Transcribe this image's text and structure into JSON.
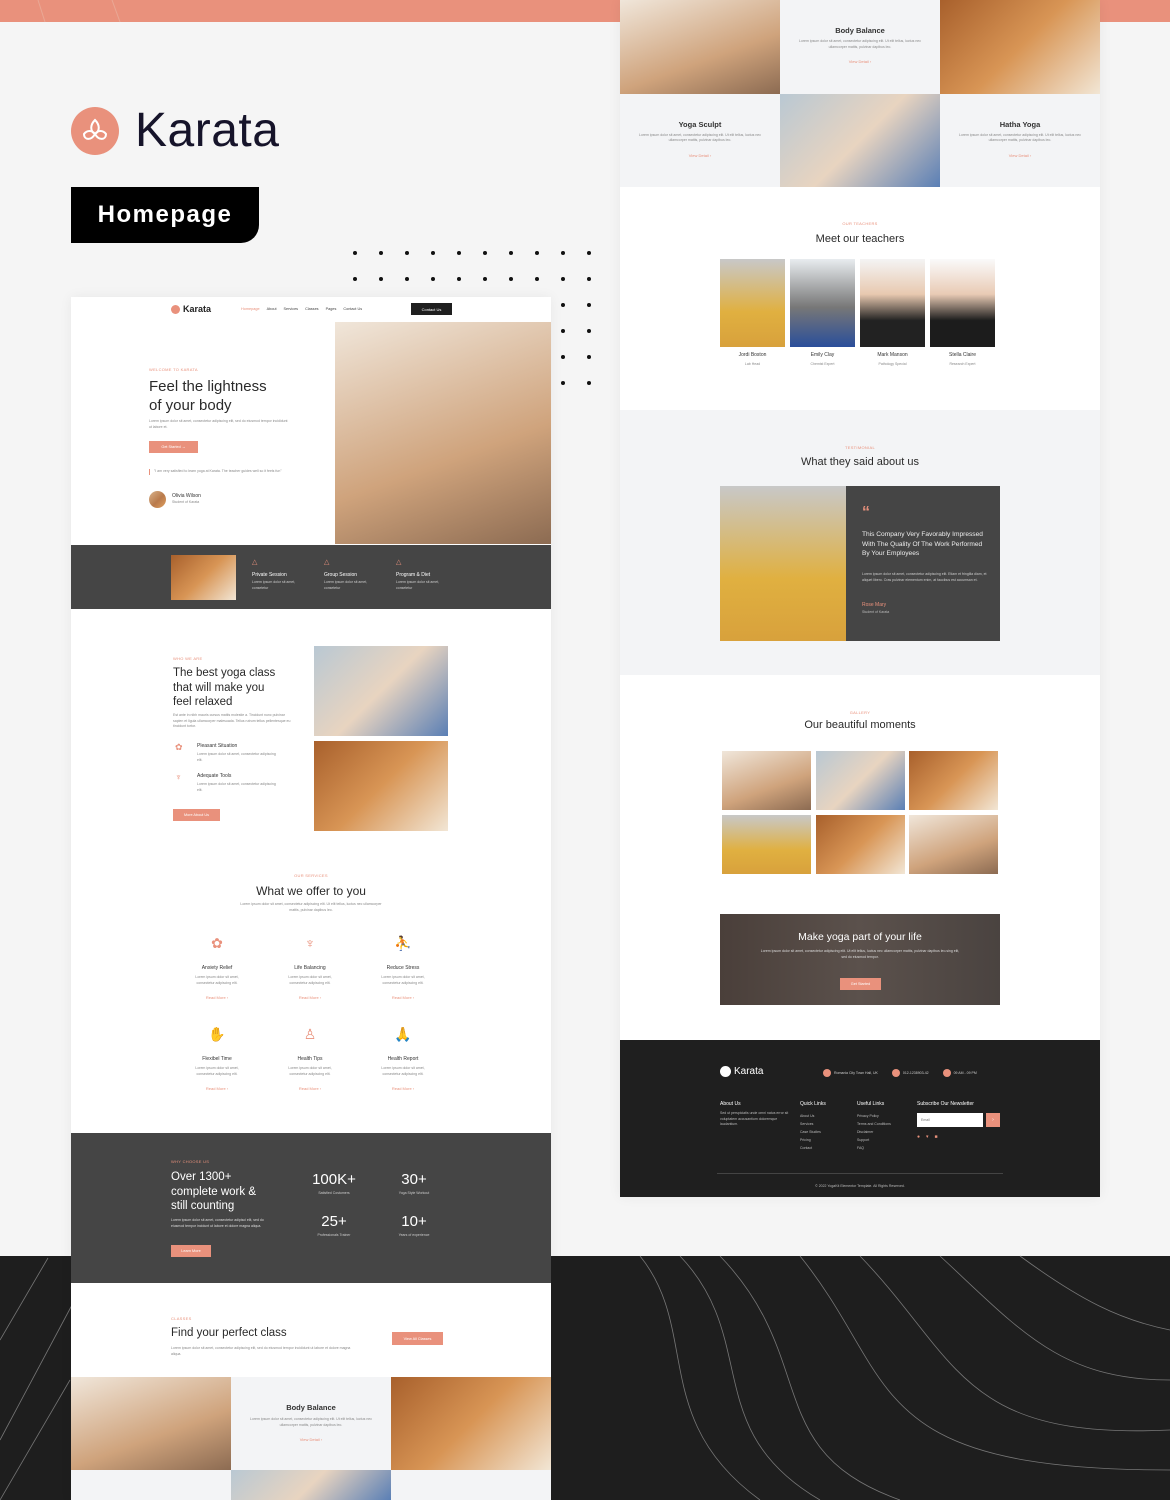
{
  "brand": {
    "name": "Karata",
    "page_tag": "Homepage",
    "accent": "#e9917c",
    "dark": "#454545"
  },
  "left": {
    "nav": {
      "logo": "Karata",
      "items": [
        "Homepage",
        "About",
        "Services",
        "Classes",
        "Pages",
        "Contact Us"
      ],
      "contact_button": "Contact Us"
    },
    "hero": {
      "label": "WELCOME TO KARATA",
      "title_line1": "Feel the lightness",
      "title_line2": "of your body",
      "text": "Lorem ipsum dolor sit amet, consectetur adipiscing elit, sed do eiusmod tempor incididunt ut labore et.",
      "button": "Get Started",
      "quote": "\"I am very satisfied to learn yoga at Karata. The teacher guides well so it feels fun\"",
      "author": "Olivia Wilson",
      "author_role": "Student of Karata"
    },
    "features": [
      {
        "title": "Private Session",
        "text": "Lorem ipsum dolor sit amet, consetetur"
      },
      {
        "title": "Group Session",
        "text": "Lorem ipsum dolor sit amet, consetetur"
      },
      {
        "title": "Program & Diet",
        "text": "Lorem ipsum dolor sit amet, consetetur"
      }
    ],
    "about": {
      "label": "WHO WE ARE",
      "title_line1": "The best yoga class",
      "title_line2": "that will make you",
      "title_line3": "feel relaxed",
      "text": "Est ante in nibh mauris cursus mattis molestie a. Tincidunt nunc pulvinar sapien et ligula ullamcorper malesuada. Tellus rutrum tellus pellentesque eu tincidunt tortor.",
      "items": [
        {
          "title": "Pleasant Situation",
          "text": "Lorem ipsum dolor sit amet, consectetur adipiscing elit."
        },
        {
          "title": "Adequate Tools",
          "text": "Lorem ipsum dolor sit amet, consectetur adipiscing elit."
        }
      ],
      "button": "More About Us"
    },
    "services": {
      "label": "OUR SERVICES",
      "title": "What we offer to you",
      "text": "Lorem ipsum dolor sit amet, consectetur adipiscing elit. Ut elit tellus, luctus nec ullamcorper mattis, pulvinar dapibus leo.",
      "items": [
        {
          "title": "Anxiety Relief",
          "icon": "lotus-icon"
        },
        {
          "title": "Life Balancing",
          "icon": "balance-icon"
        },
        {
          "title": "Reduce Stress",
          "icon": "stretch-icon"
        },
        {
          "title": "Flexibel Time",
          "icon": "hand-icon"
        },
        {
          "title": "Health Tips",
          "icon": "bottle-icon"
        },
        {
          "title": "Health Report",
          "icon": "praying-hands-icon"
        }
      ],
      "item_text": "Lorem ipsum dolor sit amet, consectetur adipiscing elit.",
      "read_more": "Read More"
    },
    "stats": {
      "label": "WHY CHOOSE US",
      "title_line1": "Over 1300+",
      "title_line2": "complete work &",
      "title_line3": "still counting",
      "text": "Lorem ipsum dolor sit amet, consectetur adipisci elit, sed do eiusmod tempor incidunt ut labore et dolore magna aliqua.",
      "button": "Learn More",
      "items": [
        {
          "value": "100K+",
          "label": "Satisfied Costumers"
        },
        {
          "value": "30+",
          "label": "Yoga Style Workout"
        },
        {
          "value": "25+",
          "label": "Professionals Trainer"
        },
        {
          "value": "10+",
          "label": "Years of experience"
        }
      ]
    },
    "classes": {
      "label": "CLASSES",
      "title": "Find your perfect class",
      "text": "Lorem ipsum dolor sit amet, consectetur adipiscing elit, sed do eiusmod tempor incididunt ut labore et dolore magna aliqua.",
      "button": "View All Classes",
      "card_title": "Body Balance",
      "card_text": "Lorem ipsum dolor sit amet, consectetur adipiscing elit. Ut elit tellus, luctus nec ullamcorper mattis, pulvinar dapibus leo.",
      "card_link": "View Detail"
    }
  },
  "right": {
    "classes": [
      {
        "title": "Body Balance"
      },
      {
        "title": "Yoga Sculpt"
      },
      {
        "title": "Hatha Yoga"
      }
    ],
    "class_text": "Lorem ipsum dolor sit amet, consectetur adipiscing elit. Ut elit tellus, luctus nec ullamcorper mattis, pulvinar dapibus leo.",
    "class_link": "View Detail",
    "teachers": {
      "label": "OUR TEACHERS",
      "title": "Meet our teachers",
      "items": [
        {
          "name": "Jordi Boston",
          "role": "Lab Head"
        },
        {
          "name": "Emily Clay",
          "role": "Chemist Expert"
        },
        {
          "name": "Mark Manson",
          "role": "Pathology Special"
        },
        {
          "name": "Stella Claire",
          "role": "Research Expert"
        }
      ]
    },
    "testimonial": {
      "label": "TESTIMONIAL",
      "title": "What they said about us",
      "quote": "This Company Very Favorably Impressed With The Quality Of The Work Performed By Your Employees",
      "text": "Lorem ipsum dolor sit amet, consectetur adipiscing elit. Etiam et fringilla diam, et aliquet libero. Cras pulvinar elementum enim, at faucibus est accumsan et.",
      "author": "Rose Mary",
      "role": "Student of Karata"
    },
    "gallery": {
      "label": "GALLERY",
      "title": "Our beautiful moments"
    },
    "cta": {
      "title": "Make yoga part of your life",
      "text": "Lorem ipsum dolor sit amet, consectetur adipiscing elit. Ut elit tellus, luctus nec ullamcorper mattis, pulvinar dapibus leo.sing elit, sed do eiusmod tempor.",
      "button": "Get Started"
    },
    "footer": {
      "logo": "Karata",
      "address": "Romania City Town Hall, UK",
      "phone": "012-1238903-42",
      "hours": "09 AM - 09 PM",
      "about_title": "About Us",
      "about_text": "Sed ut perspiciatis unde omni natus error sit voluptatem accusantium doloremque laudantium.",
      "quick_title": "Quick Links",
      "quick": [
        "About Us",
        "Services",
        "Case Studies",
        "Pricing",
        "Contact"
      ],
      "useful_title": "Useful Links",
      "useful": [
        "Privacy Policy",
        "Terms and Conditions",
        "Disclaimer",
        "Support",
        "FAQ"
      ],
      "newsletter_title": "Subscribe Our Newsletter",
      "email_placeholder": "Email",
      "copyright": "© 2022 YogaKit Elementor Template. All Rights Reserved."
    }
  }
}
